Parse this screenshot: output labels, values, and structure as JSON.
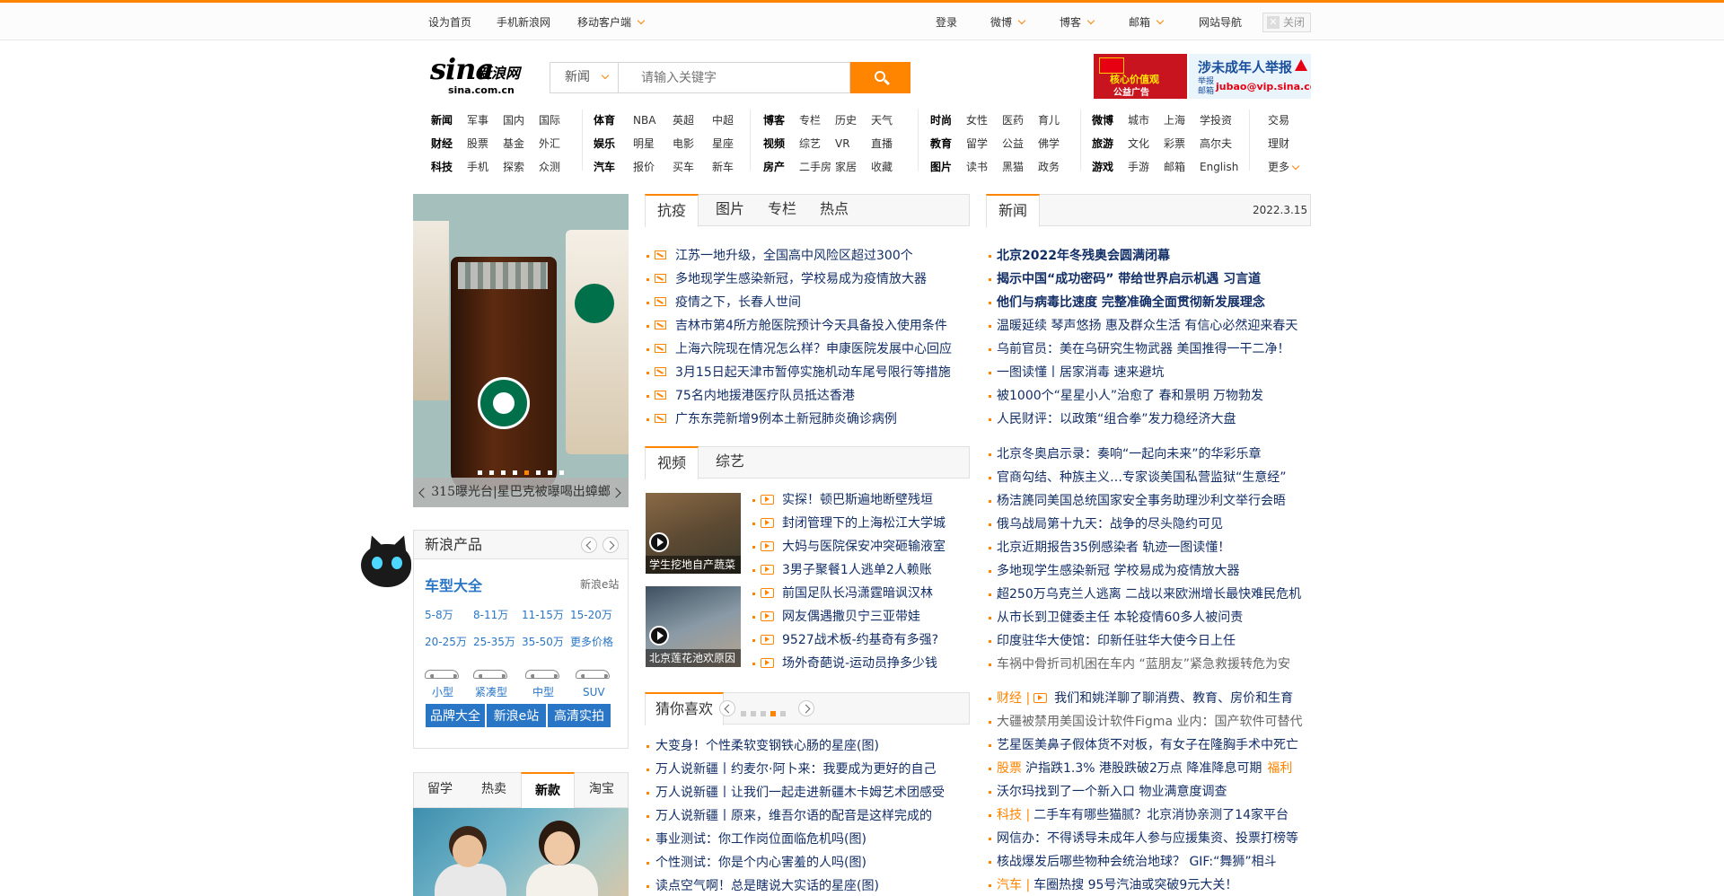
{
  "topbar": {
    "left": [
      "设为首页",
      "手机新浪网",
      "移动客户端"
    ],
    "right": [
      "登录",
      "微博",
      "博客",
      "邮箱",
      "网站导航"
    ],
    "close": "关闭"
  },
  "header": {
    "logo_text": "sina",
    "logo_cn": "新浪网",
    "logo_domain": "sina.com.cn",
    "search_category": "新闻",
    "search_placeholder": "请输入关键字",
    "ad1": {
      "line1": "核心价值观",
      "line2": "公益广告"
    },
    "ad2": {
      "title": "涉未成年人举报",
      "sub": "举报\n邮箱",
      "email": "jubao@vip.sina.com"
    }
  },
  "nav": [
    [
      [
        "新闻",
        "军事",
        "国内",
        "国际"
      ],
      [
        "财经",
        "股票",
        "基金",
        "外汇"
      ],
      [
        "科技",
        "手机",
        "探索",
        "众测"
      ]
    ],
    [
      [
        "体育",
        "NBA",
        "英超",
        "中超"
      ],
      [
        "娱乐",
        "明星",
        "电影",
        "星座"
      ],
      [
        "汽车",
        "报价",
        "买车",
        "新车"
      ]
    ],
    [
      [
        "博客",
        "专栏",
        "历史",
        "天气"
      ],
      [
        "视频",
        "综艺",
        "VR",
        "直播"
      ],
      [
        "房产",
        "二手房",
        "家居",
        "收藏"
      ]
    ],
    [
      [
        "时尚",
        "女性",
        "医药",
        "育儿"
      ],
      [
        "教育",
        "留学",
        "公益",
        "佛学"
      ],
      [
        "图片",
        "读书",
        "黑猫",
        "政务"
      ]
    ],
    [
      [
        "微博",
        "城市",
        "上海",
        "学投资"
      ],
      [
        "旅游",
        "文化",
        "彩票",
        "高尔夫"
      ],
      [
        "游戏",
        "手游",
        "邮箱",
        "English"
      ]
    ],
    [
      [
        "交易"
      ],
      [
        "理财"
      ],
      [
        "更多"
      ]
    ]
  ],
  "slider": {
    "caption": "315曝光台|星巴克被曝喝出蟑螂",
    "dot_count": 8,
    "active_dot": 4
  },
  "panel_mid": {
    "tabs": [
      "抗疫",
      "图片",
      "专栏",
      "热点"
    ],
    "items": [
      "江苏一地升级，全国高中风险区超过300个",
      "多地现学生感染新冠，学校易成为疫情放大器",
      "疫情之下，长春人世间",
      "吉林市第4所方舱医院预计今天具备投入使用条件",
      "上海六院现在情况怎么样？申康医院发展中心回应",
      "3月15日起天津市暂停实施机动车尾号限行等措施",
      "75名内地援港医疗队员抵达香港",
      "广东东莞新增9例本土新冠肺炎确诊病例"
    ]
  },
  "panel_video": {
    "tabs": [
      "视频",
      "综艺"
    ],
    "thumbs": [
      "学生挖地自产蔬菜",
      "北京莲花池欢原因"
    ],
    "items": [
      "实探！顿巴斯遍地断壁残垣",
      "封闭管理下的上海松江大学城",
      "大妈与医院保安冲突砸输液室",
      "3男子聚餐1人逃单2人赖账",
      "前国足队长冯潇霆暗讽汉林",
      "网友偶遇撒贝宁三亚带娃",
      "9527战术板-约基奇有多强?",
      "场外奇葩说-运动员挣多少钱"
    ]
  },
  "panel_guess": {
    "title": "猜你喜欢",
    "dot_count": 5,
    "active_dot": 3,
    "items": [
      "大变身！个性柔软变钢铁心肠的星座(图)",
      "万人说新疆丨约麦尔·阿卜来：我要成为更好的自己",
      "万人说新疆丨让我们一起走进新疆木卡姆艺术团感受",
      "万人说新疆丨原来，维吾尔语的配音是这样完成的",
      "事业测试：你工作岗位面临危机吗(图)",
      "个性测试：你是个内心害羞的人吗(图)",
      "读点空气啊！总是瞎说大实话的星座(图)"
    ]
  },
  "panel_news": {
    "tab": "新闻",
    "date": "2022.3.15",
    "group1": [
      {
        "t": "北京2022年冬残奥会圆满闭幕",
        "style": "bold"
      },
      {
        "t": "揭示中国“成功密码” 带给世界启示机遇 习言道",
        "style": "bold"
      },
      {
        "t": "他们与病毒比速度 完整准确全面贯彻新发展理念",
        "style": "bold"
      },
      {
        "t": "温暖延续 琴声悠扬 惠及群众生活 有信心必然迎来春天",
        "style": "blue"
      },
      {
        "t": "乌前官员：美在乌研究生物武器 美国推得一干二净！",
        "style": "blue"
      },
      {
        "t": "一图读懂丨居家消毒 速来避坑",
        "style": "blue"
      },
      {
        "t": "被1000个“星星小人”治愈了 春和景明 万物勃发",
        "style": "blue"
      },
      {
        "t": "人民财评：以政策“组合拳”发力稳经济大盘",
        "style": "blue"
      }
    ],
    "group2": [
      "北京冬奥启示录：奏响“一起向未来”的华彩乐章",
      "官商勾结、种族主义…专家谈美国私营监狱“生意经”",
      "杨洁篪同美国总统国家安全事务助理沙利文举行会晤",
      "俄乌战局第十九天：战争的尽头隐约可见",
      "北京近期报告35例感染者 轨迹一图读懂！",
      "多地现学生感染新冠 学校易成为疫情放大器",
      "超250万乌克兰人逃离 二战以来欧洲增长最快难民危机",
      "从市长到卫健委主任 本轮疫情60多人被问责",
      "印度驻华大使馆：印新任驻华大使今日上任",
      "车祸中骨折司机困在车内 “蓝朋友”紧急救援转危为安"
    ],
    "group3": [
      {
        "pre": "财经 |",
        "icon": true,
        "t": "我们和姚洋聊了聊消费、教育、房价和生育"
      },
      {
        "pre": "",
        "t": "大疆被禁用美国设计软件Figma 业内：国产软件可替代"
      },
      {
        "pre": "",
        "t": "艺星医美鼻子假体货不对板，有女子在隆胸手术中死亡"
      },
      {
        "pre": "股票",
        "t": "沪指跌1.3% 港股跌破2万点 降准降息可期",
        "post": "福利"
      },
      {
        "pre": "",
        "t": "沃尔玛找到了一个新入口 物业满意度调查"
      },
      {
        "pre": "科技 |",
        "t": "二手车有哪些猫腻？北京消协亲测了14家平台"
      },
      {
        "pre": "",
        "t": "网信办：不得诱导未成年人参与应援集资、投票打榜等"
      },
      {
        "pre": "",
        "t": "核战爆发后哪些物种会统治地球？ GIF:“舞狮”相斗"
      },
      {
        "pre": "汽车 |",
        "t": "车圈热搜 95号汽油或突破9元大关！"
      }
    ]
  },
  "products": {
    "title": "新浪产品",
    "section": "车型大全",
    "section_link": "新浪e站",
    "prices": [
      "5-8万",
      "8-11万",
      "11-15万",
      "15-20万",
      "20-25万",
      "25-35万",
      "35-50万",
      "更多价格"
    ],
    "car_types": [
      "小型",
      "紧凑型",
      "中型",
      "SUV"
    ],
    "buttons": [
      "品牌大全",
      "新浪e站",
      "高清实拍"
    ]
  },
  "bottom_tabs": [
    "留学",
    "热卖",
    "新款",
    "淘宝"
  ],
  "bottom_active": 2,
  "colors": {
    "accent": "#ff8400",
    "link_blue": "#122e67",
    "product_blue": "#2a76c6"
  }
}
